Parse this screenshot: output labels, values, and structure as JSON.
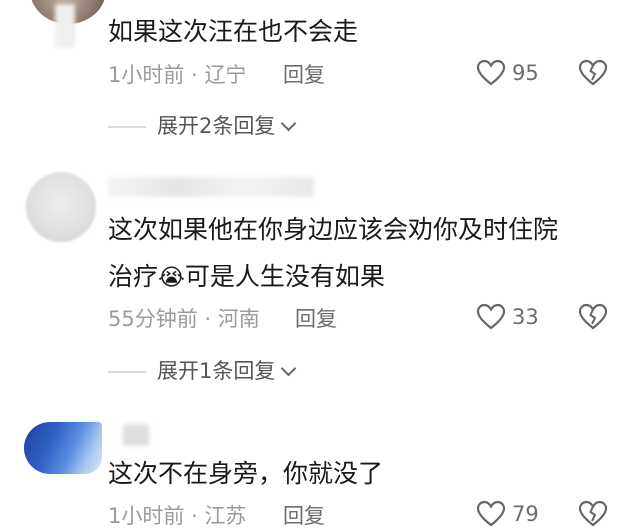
{
  "comments": [
    {
      "text": "如果这次汪在也不会走",
      "time": "1小时前",
      "location": "辽宁",
      "reply_label": "回复",
      "likes": "95",
      "expand_label": "展开2条回复"
    },
    {
      "text_line1": "这次如果他在你身边应该会劝你及时住院",
      "text_line2_before": "治疗",
      "emoji": "😭",
      "text_line2_after": "可是人生没有如果",
      "time": "55分钟前",
      "location": "河南",
      "reply_label": "回复",
      "likes": "33",
      "expand_label": "展开1条回复"
    },
    {
      "text": "这次不在身旁，你就没了",
      "time": "1小时前",
      "location": "江苏",
      "reply_label": "回复",
      "likes": "79"
    }
  ],
  "separator": "·",
  "colors": {
    "text": "#1a1a1a",
    "meta": "#9b9b9b",
    "icon": "#666666"
  }
}
